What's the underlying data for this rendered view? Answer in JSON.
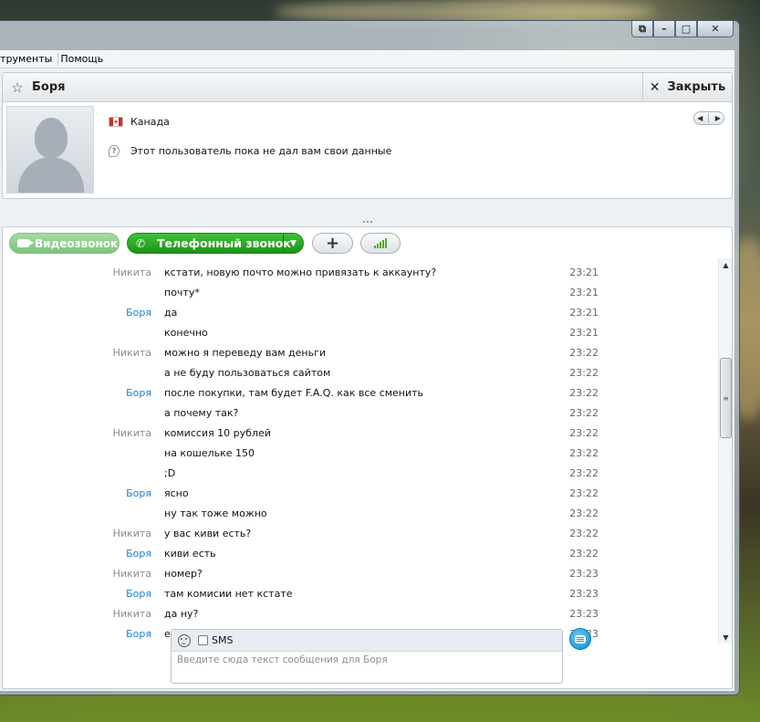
{
  "window": {
    "caption_buttons": [
      "restore",
      "minimize",
      "maximize",
      "close"
    ]
  },
  "menu": {
    "items": [
      {
        "label": "струменты"
      },
      {
        "label": "Помощь"
      }
    ]
  },
  "contact": {
    "name": "Боря",
    "close_label": "Закрыть",
    "country": "Канада",
    "info_text": "Этот пользователь пока не дал вам свои данные"
  },
  "call_bar": {
    "video_label": "Видеозвонок",
    "phone_label": "Телефонный звонок",
    "add_label": "+"
  },
  "chat": {
    "messages": [
      {
        "who": "Никита",
        "text": "кстати, новую почто можно привязать к аккаунту?",
        "time": "23:21"
      },
      {
        "who": "",
        "text": "почту*",
        "time": "23:21"
      },
      {
        "who": "Боря",
        "text": "да",
        "time": "23:21"
      },
      {
        "who": "",
        "text": "конечно",
        "time": "23:21"
      },
      {
        "who": "Никита",
        "text": "можно я переведу вам деньги",
        "time": "23:22"
      },
      {
        "who": "",
        "text": "а не буду пользоваться сайтом",
        "time": "23:22"
      },
      {
        "who": "Боря",
        "text": "после покупки, там будет F.A.Q. как все сменить",
        "time": "23:22"
      },
      {
        "who": "",
        "text": "а почему так?",
        "time": "23:22"
      },
      {
        "who": "Никита",
        "text": "комиссия 10 рублей",
        "time": "23:22"
      },
      {
        "who": "",
        "text": "на кошельке 150",
        "time": "23:22"
      },
      {
        "who": "",
        "text": ";D",
        "time": "23:22"
      },
      {
        "who": "Боря",
        "text": "ясно",
        "time": "23:22"
      },
      {
        "who": "",
        "text": "ну так тоже можно",
        "time": "23:22"
      },
      {
        "who": "Никита",
        "text": "у вас киви есть?",
        "time": "23:22"
      },
      {
        "who": "Боря",
        "text": "киви есть",
        "time": "23:22"
      },
      {
        "who": "Никита",
        "text": "номер?",
        "time": "23:23"
      },
      {
        "who": "Боря",
        "text": "там комисии нет кстате",
        "time": "23:23"
      },
      {
        "who": "Никита",
        "text": "да ну?",
        "time": "23:23"
      },
      {
        "who": "Боря",
        "text": "если кидать через wm",
        "time": "23:23"
      }
    ]
  },
  "composer": {
    "sms_label": "SMS",
    "sms_checked": false,
    "placeholder": "Введите сюда текст сообщения для Боря"
  },
  "colors": {
    "sender_self": "#8a8a8a",
    "sender_contact": "#1c7fd1",
    "phone_green": "#2aa824",
    "video_green": "#8ccf89",
    "send_blue": "#1a9be0"
  }
}
